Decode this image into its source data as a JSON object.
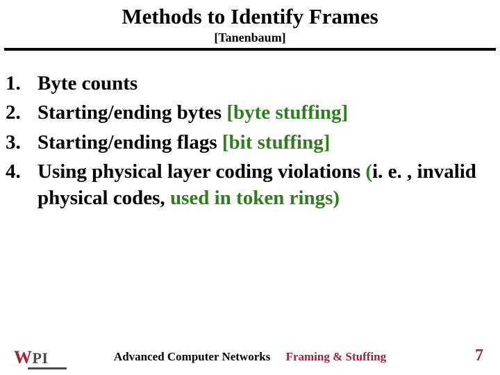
{
  "header": {
    "title": "Methods to Identify Frames",
    "subtitle": "[Tanenbaum]"
  },
  "list": {
    "n1": "1.",
    "n2": "2.",
    "n3": "3.",
    "n4": "4.",
    "item1": "Byte counts",
    "item2a": "Starting/ending bytes ",
    "item2b": "[byte stuffing]",
    "item3a": "Starting/ending flags ",
    "item3b": "[bit stuffing]",
    "item4a": "Using physical layer coding  violations ",
    "item4b_open": "(",
    "item4b_mid": "i. e. , invalid physical codes, ",
    "item4c": "used in token rings",
    "item4b_close": ")"
  },
  "footer": {
    "logo_w": "W",
    "logo_p": "P",
    "logo_i": "I",
    "course": "Advanced Computer Networks",
    "topic": "Framing & Stuffing",
    "page": "7"
  }
}
